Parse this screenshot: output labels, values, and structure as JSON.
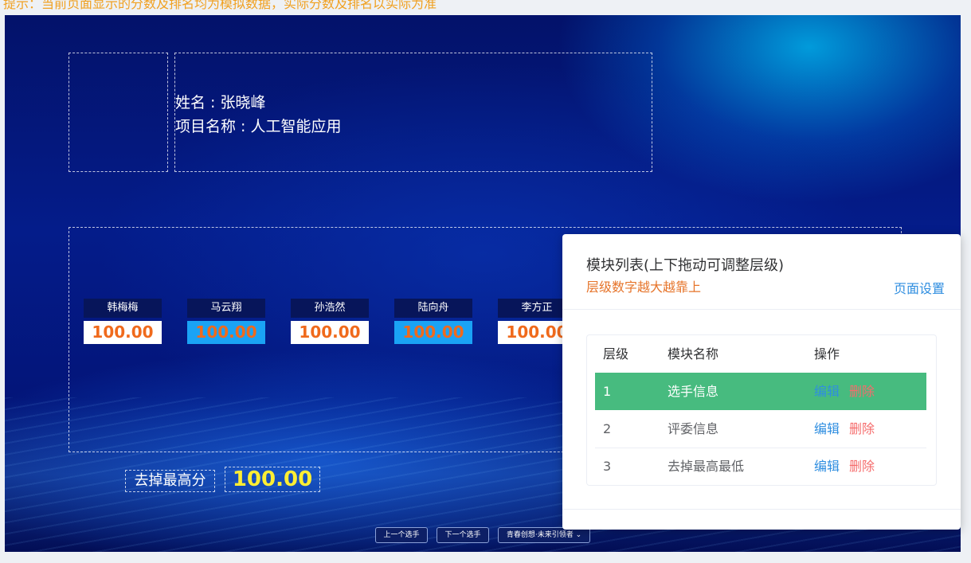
{
  "hint": "提示：当前页面显示的分数及排名均为模拟数据，实际分数及排名以实际为准",
  "player": {
    "name_line": "姓名 : 张晓峰",
    "project_line": "项目名称 : 人工智能应用"
  },
  "judges": [
    {
      "name": "韩梅梅",
      "score": "100.00"
    },
    {
      "name": "马云翔",
      "score": "100.00"
    },
    {
      "name": "孙浩然",
      "score": "100.00"
    },
    {
      "name": "陆向舟",
      "score": "100.00"
    },
    {
      "name": "李方正",
      "score": "100.00"
    }
  ],
  "drop": {
    "label": "去掉最高分",
    "score": "100.00"
  },
  "nav": {
    "prev": "上一个选手",
    "next": "下一个选手",
    "select": "青春创想·未来引领者"
  },
  "panel": {
    "title": "模块列表(上下拖动可调整层级)",
    "subtitle": "层级数字越大越靠上",
    "settings_link": "页面设置",
    "columns": [
      "层级",
      "模块名称",
      "操作"
    ],
    "rows": [
      {
        "level": "1",
        "name": "选手信息",
        "edit": "编辑",
        "delete": "删除"
      },
      {
        "level": "2",
        "name": "评委信息",
        "edit": "编辑",
        "delete": "删除"
      },
      {
        "level": "3",
        "name": "去掉最高最低",
        "edit": "编辑",
        "delete": "删除"
      }
    ]
  },
  "colors": {
    "accent_green": "#47bb7f",
    "link_blue": "#2f8ee0",
    "danger_red": "#f56c6c",
    "score_orange": "#f06a1c",
    "highlight_yellow": "#ffee33"
  }
}
